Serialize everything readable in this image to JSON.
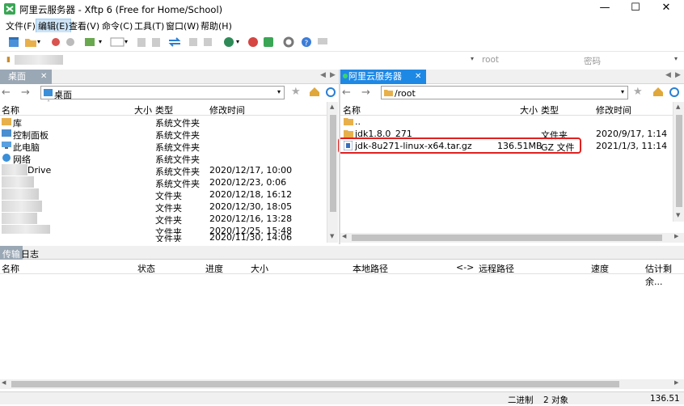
{
  "window": {
    "title": "阿里云服务器 - Xftp 6 (Free for Home/School)",
    "controls": {
      "minimize": "—",
      "maximize": "☐",
      "close": "✕"
    }
  },
  "menu": [
    "文件(F)",
    "编辑(E)",
    "查看(V)",
    "命令(C)",
    "工具(T)",
    "窗口(W)",
    "帮助(H)"
  ],
  "address": {
    "host_placeholder": "root",
    "password_placeholder": "密码"
  },
  "left_pane": {
    "tab": "桌面",
    "path": "桌面",
    "columns": {
      "name": "名称",
      "size": "大小",
      "type": "类型",
      "modified": "修改时间"
    },
    "rows": [
      {
        "name": "库",
        "size": "",
        "type": "系统文件夹",
        "modified": ""
      },
      {
        "name": "控制面板",
        "size": "",
        "type": "系统文件夹",
        "modified": ""
      },
      {
        "name": "此电脑",
        "size": "",
        "type": "系统文件夹",
        "modified": ""
      },
      {
        "name": "网络",
        "size": "",
        "type": "系统文件夹",
        "modified": ""
      },
      {
        "name": "Drive",
        "size": "",
        "type": "系统文件夹",
        "modified": "2020/12/17, 10:00"
      },
      {
        "name": "",
        "size": "",
        "type": "系统文件夹",
        "modified": "2020/12/23, 0:06"
      },
      {
        "name": "",
        "size": "",
        "type": "文件夹",
        "modified": "2020/12/18, 16:12"
      },
      {
        "name": "",
        "size": "",
        "type": "文件夹",
        "modified": "2020/12/30, 18:05"
      },
      {
        "name": "",
        "size": "",
        "type": "文件夹",
        "modified": "2020/12/16, 13:28"
      },
      {
        "name": "",
        "size": "",
        "type": "文件夹",
        "modified": "2020/12/25, 15:48"
      },
      {
        "name": "",
        "size": "",
        "type": "文件夹",
        "modified": "2020/11/30, 14:06"
      }
    ]
  },
  "right_pane": {
    "tab": "阿里云服务器",
    "path": "/root",
    "columns": {
      "name": "名称",
      "size": "大小",
      "type": "类型",
      "modified": "修改时间"
    },
    "rows": [
      {
        "name": "..",
        "size": "",
        "type": "",
        "modified": ""
      },
      {
        "name": "jdk1.8.0_271",
        "size": "",
        "type": "文件夹",
        "modified": "2020/9/17, 1:14"
      },
      {
        "name": "jdk-8u271-linux-x64.tar.gz",
        "size": "136.51MB",
        "type": "GZ 文件",
        "modified": "2021/1/3, 11:14"
      }
    ],
    "highlight_color": "#e02020"
  },
  "transfer": {
    "tabs": [
      "传输",
      "日志"
    ],
    "columns": [
      "名称",
      "状态",
      "进度",
      "大小",
      "本地路径",
      "<->",
      "远程路径",
      "速度",
      "估计剩余..."
    ]
  },
  "statusbar": {
    "mode": "二进制",
    "objects": "2 对象",
    "size": "136.51"
  },
  "colors": {
    "accent": "#1e88e5",
    "inactive_tab": "#9aa7b5"
  }
}
